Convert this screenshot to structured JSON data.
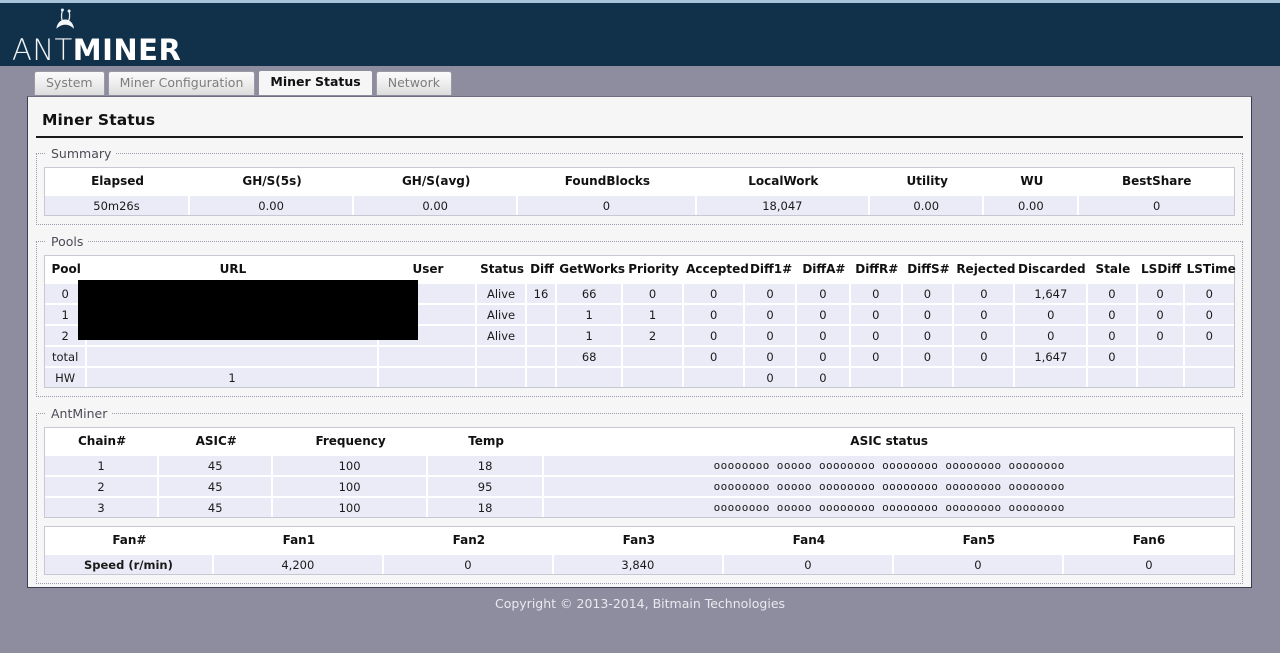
{
  "brand": {
    "name_light": "ANT",
    "name_bold": "MINER",
    "logo_icon": "ant-icon"
  },
  "tabs": [
    {
      "label": "System",
      "active": false
    },
    {
      "label": "Miner Configuration",
      "active": false
    },
    {
      "label": "Miner Status",
      "active": true
    },
    {
      "label": "Network",
      "active": false
    }
  ],
  "page": {
    "title": "Miner Status"
  },
  "summary": {
    "legend": "Summary",
    "headers": [
      "Elapsed",
      "GH/S(5s)",
      "GH/S(avg)",
      "FoundBlocks",
      "LocalWork",
      "Utility",
      "WU",
      "BestShare"
    ],
    "row": [
      "50m26s",
      "0.00",
      "0.00",
      "0",
      "18,047",
      "0.00",
      "0.00",
      "0"
    ]
  },
  "pools": {
    "legend": "Pools",
    "headers": [
      "Pool",
      "URL",
      "User",
      "Status",
      "Diff",
      "GetWorks",
      "Priority",
      "Accepted",
      "Diff1#",
      "DiffA#",
      "DiffR#",
      "DiffS#",
      "Rejected",
      "Discarded",
      "Stale",
      "LSDiff",
      "LSTime"
    ],
    "rows": [
      [
        "0",
        "",
        "",
        "Alive",
        "16",
        "66",
        "0",
        "0",
        "0",
        "0",
        "0",
        "0",
        "0",
        "1,647",
        "0",
        "0",
        "0"
      ],
      [
        "1",
        "",
        "",
        "Alive",
        "",
        "1",
        "1",
        "0",
        "0",
        "0",
        "0",
        "0",
        "0",
        "0",
        "0",
        "0",
        "0"
      ],
      [
        "2",
        "",
        "",
        "Alive",
        "",
        "1",
        "2",
        "0",
        "0",
        "0",
        "0",
        "0",
        "0",
        "0",
        "0",
        "0",
        "0"
      ],
      [
        "total",
        "",
        "",
        "",
        "",
        "68",
        "",
        "0",
        "0",
        "0",
        "0",
        "0",
        "0",
        "1,647",
        "0",
        "",
        ""
      ],
      [
        "HW",
        "1",
        "",
        "",
        "",
        "",
        "",
        "",
        "0",
        "0",
        "",
        "",
        "",
        "",
        "",
        "",
        ""
      ]
    ],
    "redacted_note": "url-user-redacted-black-box"
  },
  "antminer": {
    "legend": "AntMiner",
    "headers": [
      "Chain#",
      "ASIC#",
      "Frequency",
      "Temp",
      "ASIC status"
    ],
    "rows": [
      [
        "1",
        "45",
        "100",
        "18",
        "oooooooo ooooo oooooooo oooooooo oooooooo oooooooo"
      ],
      [
        "2",
        "45",
        "100",
        "95",
        "oooooooo ooooo oooooooo oooooooo oooooooo oooooooo"
      ],
      [
        "3",
        "45",
        "100",
        "18",
        "oooooooo ooooo oooooooo oooooooo oooooooo oooooooo"
      ]
    ]
  },
  "fans": {
    "headers": [
      "Fan#",
      "Fan1",
      "Fan2",
      "Fan3",
      "Fan4",
      "Fan5",
      "Fan6"
    ],
    "row_label": "Speed (r/min)",
    "values": [
      "4,200",
      "0",
      "3,840",
      "0",
      "0",
      "0"
    ]
  },
  "footer": {
    "copyright": "Copyright © 2013-2014, Bitmain Technologies"
  }
}
